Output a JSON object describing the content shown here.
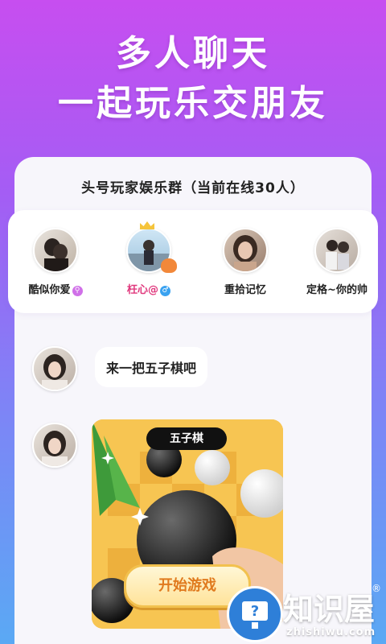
{
  "promo": {
    "line1": "多人聊天",
    "line2": "一起玩乐交朋友"
  },
  "group": {
    "title": "头号玩家娱乐群（当前在线30人）",
    "members": [
      {
        "name": "酷似你爱",
        "badge": "⚲",
        "badge_color": "#d070e8"
      },
      {
        "name": "枉心@",
        "badge": "♂",
        "badge_color": "#3aa2f0",
        "name_color": "#e0387d"
      },
      {
        "name": "重拾记忆"
      },
      {
        "name": "定格~你的帅"
      }
    ]
  },
  "chat": {
    "message1": "来一把五子棋吧",
    "game_card": {
      "tag": "五子棋",
      "button": "开始游戏"
    }
  },
  "watermark": {
    "text": "知识屋",
    "sub": "zhishiwu.com",
    "reg": "®",
    "icon": "question-monitor-icon"
  }
}
